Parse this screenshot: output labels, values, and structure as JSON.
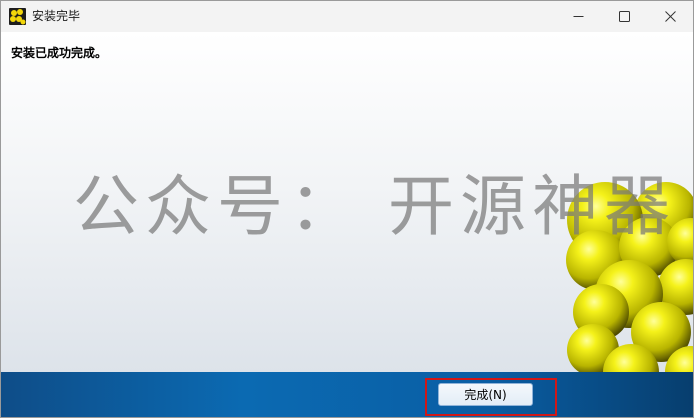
{
  "window": {
    "title": "安装完毕",
    "icon": "app-logo-icon",
    "controls": [
      "minimize-icon",
      "maximize-icon",
      "close-icon"
    ]
  },
  "content": {
    "message": "安装已成功完成。",
    "watermark": "公众号： 开源神器"
  },
  "footer": {
    "finish_label": "完成(N)"
  },
  "colors": {
    "accent_bar": "#0b6ab2",
    "highlight": "#d01717",
    "sphere": "#e0de0a"
  }
}
